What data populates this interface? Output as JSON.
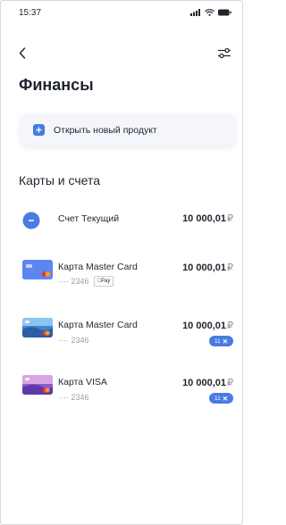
{
  "status_bar": {
    "time": "15:37"
  },
  "header": {
    "title": "Финансы"
  },
  "new_product": {
    "label": "Открыть новый продукт"
  },
  "section": {
    "title": "Карты и счета"
  },
  "accounts": [
    {
      "name": "Счет Текущий",
      "amount": "10 000,01",
      "currency": "₽"
    },
    {
      "name": "Карта Master Card",
      "mask": "···· 2346",
      "badge": "Pay",
      "amount": "10 000,01",
      "currency": "₽"
    },
    {
      "name": "Карта Master Card",
      "mask": "···· 2346",
      "amount": "10 000,01",
      "currency": "₽",
      "tag": "11"
    },
    {
      "name": "Карта VISA",
      "mask": "···· 2346",
      "amount": "10 000,01",
      "currency": "₽",
      "tag": "11"
    }
  ],
  "colors": {
    "accent": "#4a7ae3",
    "text": "#1f2430",
    "muted": "#9aa0ab"
  }
}
